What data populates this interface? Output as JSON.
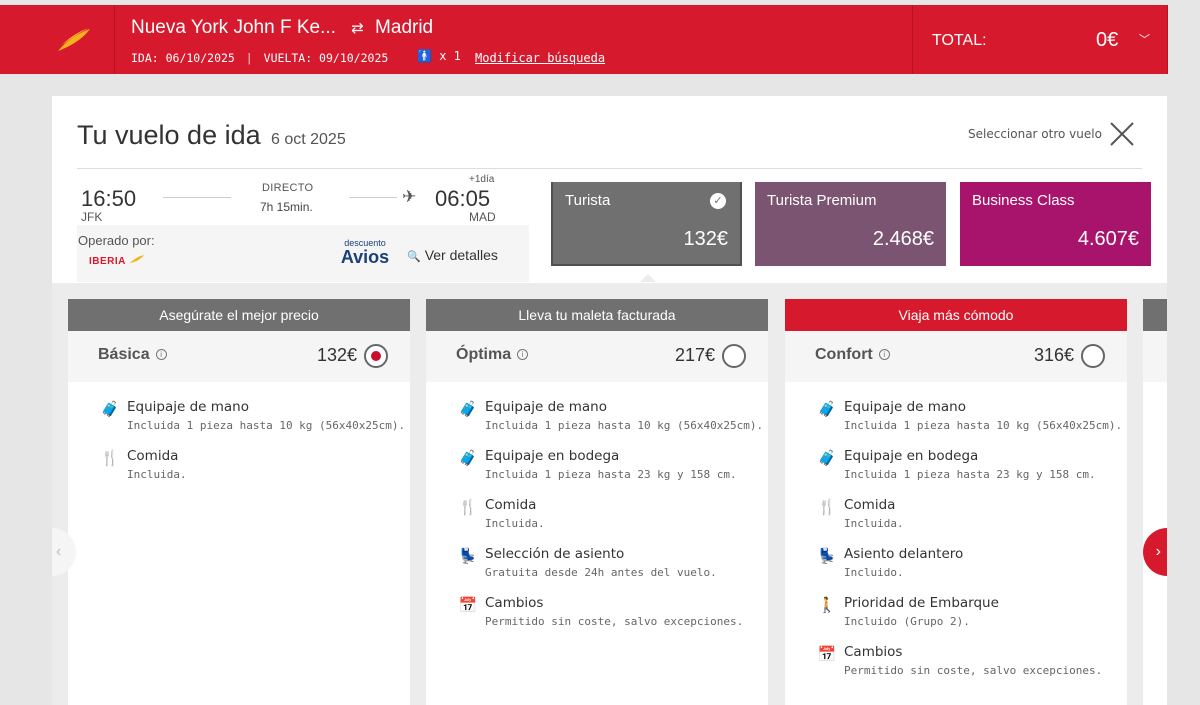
{
  "header": {
    "origin": "Nueva York John F Ke...",
    "destination": "Madrid",
    "outbound": "IDA: 06/10/2025",
    "return": "VUELTA: 09/10/2025",
    "passengers": "x 1",
    "modify": "Modificar búsqueda",
    "total_label": "TOTAL:",
    "total_value": "0€",
    "accent_color": "#d7192d"
  },
  "flight": {
    "title": "Tu vuelo de ida",
    "date": "6 oct 2025",
    "select_other": "Seleccionar otro vuelo",
    "dep_time": "16:50",
    "dep_code": "JFK",
    "type": "DIRECTO",
    "duration": "7h 15min.",
    "plus_day": "+1día",
    "arr_time": "06:05",
    "arr_code": "MAD",
    "operated_label": "Operado por:",
    "operator": "IBERIA",
    "avios_small": "descuento",
    "avios_big": "Avios",
    "details": "Ver detalles"
  },
  "cabins": [
    {
      "name": "Turista",
      "price": "132€",
      "color": "#707070",
      "selected": true
    },
    {
      "name": "Turista Premium",
      "price": "2.468€",
      "color": "#7b5472"
    },
    {
      "name": "Business Class",
      "price": "4.607€",
      "color": "#a8136b"
    }
  ],
  "fares": [
    {
      "header": "Asegúrate el mejor precio",
      "header_color": "#707070",
      "name": "Básica",
      "price": "132€",
      "selected": true,
      "features": [
        {
          "icon": "carry-on-icon",
          "title": "Equipaje de mano",
          "desc": "Incluida 1 pieza hasta 10 kg (56x40x25cm)."
        },
        {
          "icon": "meal-icon",
          "title": "Comida",
          "desc": "Incluida."
        }
      ]
    },
    {
      "header": "Lleva tu maleta facturada",
      "header_color": "#707070",
      "name": "Óptima",
      "price": "217€",
      "selected": false,
      "features": [
        {
          "icon": "carry-on-icon",
          "title": "Equipaje de mano",
          "desc": "Incluida 1 pieza hasta 10 kg (56x40x25cm)."
        },
        {
          "icon": "checked-bag-icon",
          "title": "Equipaje en bodega",
          "desc": "Incluida 1 pieza hasta 23 kg y 158 cm."
        },
        {
          "icon": "meal-icon",
          "title": "Comida",
          "desc": "Incluida."
        },
        {
          "icon": "seat-icon",
          "title": "Selección de asiento",
          "desc": "Gratuita desde 24h antes del vuelo."
        },
        {
          "icon": "calendar-icon",
          "title": "Cambios",
          "desc": "Permitido sin coste, salvo excepciones."
        }
      ]
    },
    {
      "header": "Viaja más cómodo",
      "header_color": "#d7192d",
      "name": "Confort",
      "price": "316€",
      "selected": false,
      "features": [
        {
          "icon": "carry-on-icon",
          "title": "Equipaje de mano",
          "desc": "Incluida 1 pieza hasta 10 kg (56x40x25cm)."
        },
        {
          "icon": "checked-bag-icon",
          "title": "Equipaje en bodega",
          "desc": "Incluida 1 pieza hasta 23 kg y 158 cm."
        },
        {
          "icon": "meal-icon",
          "title": "Comida",
          "desc": "Incluida."
        },
        {
          "icon": "front-seat-icon",
          "title": "Asiento delantero",
          "desc": "Incluido."
        },
        {
          "icon": "priority-boarding-icon",
          "title": "Prioridad de Embarque",
          "desc": "Incluido (Grupo 2)."
        },
        {
          "icon": "calendar-icon",
          "title": "Cambios",
          "desc": "Permitido sin coste, salvo excepciones."
        }
      ]
    }
  ]
}
